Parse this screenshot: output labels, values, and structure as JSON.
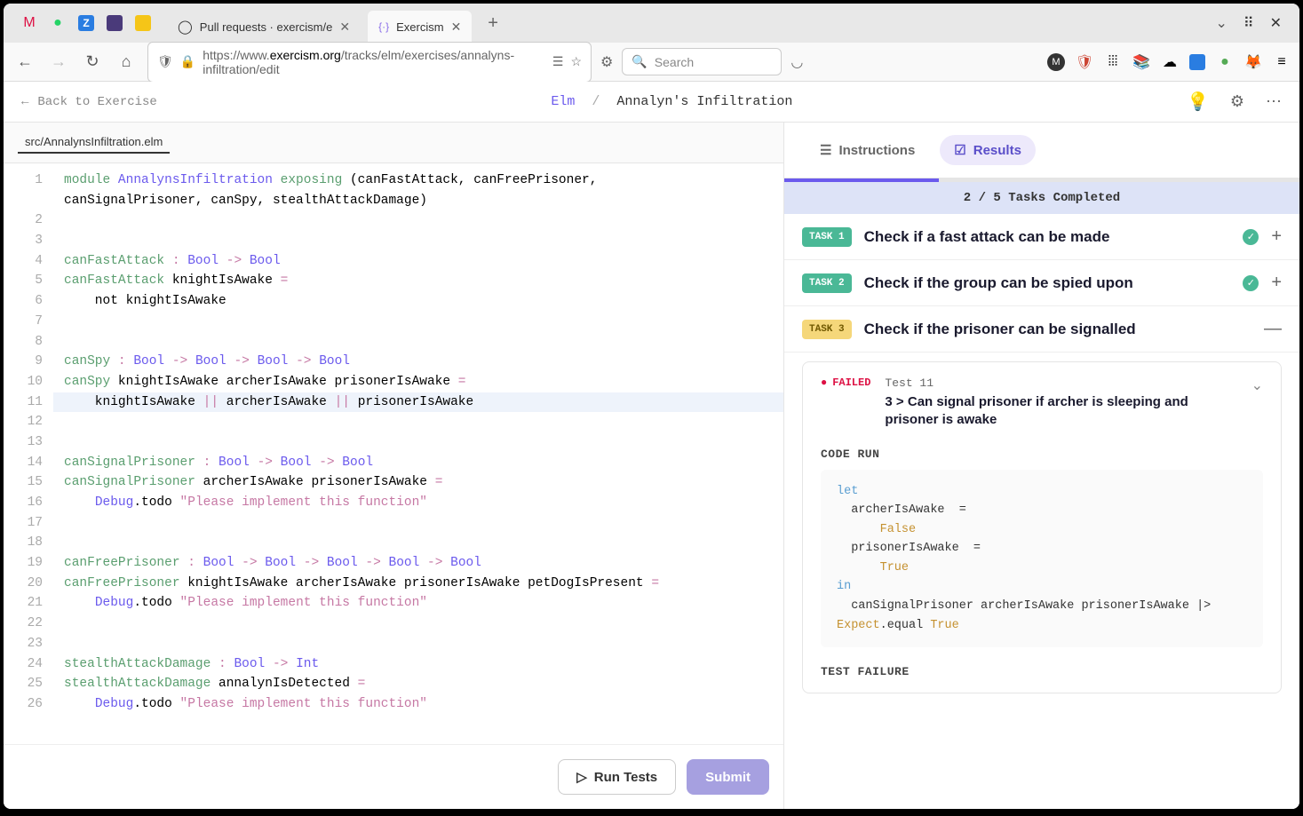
{
  "browser": {
    "tabs": [
      {
        "label": "Pull requests · exercism/e",
        "active": false
      },
      {
        "label": "Exercism",
        "active": true
      }
    ],
    "url_prefix": "https://www.",
    "url_domain": "exercism.org",
    "url_path": "/tracks/elm/exercises/annalyns-infiltration/edit",
    "search_placeholder": "Search"
  },
  "header": {
    "back_label": "Back to Exercise",
    "track": "Elm",
    "sep": "/",
    "exercise": "Annalyn's Infiltration"
  },
  "file_tab": "src/AnnalynsInfiltration.elm",
  "code_lines": [
    {
      "n": 1,
      "segs": [
        [
          "kw",
          "module "
        ],
        [
          "ty",
          "AnnalynsInfiltration "
        ],
        [
          "kw",
          "exposing "
        ],
        [
          "",
          "(canFastAttack, canFreePrisoner,"
        ]
      ]
    },
    {
      "n": "",
      "segs": [
        [
          "",
          "canSignalPrisoner, canSpy, stealthAttackDamage)"
        ]
      ]
    },
    {
      "n": 2,
      "segs": [
        [
          "",
          ""
        ]
      ]
    },
    {
      "n": 3,
      "segs": [
        [
          "",
          ""
        ]
      ]
    },
    {
      "n": 4,
      "segs": [
        [
          "ident",
          "canFastAttack "
        ],
        [
          "op",
          ": "
        ],
        [
          "ty",
          "Bool "
        ],
        [
          "op",
          "-> "
        ],
        [
          "ty",
          "Bool"
        ]
      ]
    },
    {
      "n": 5,
      "segs": [
        [
          "ident",
          "canFastAttack "
        ],
        [
          "",
          "knightIsAwake "
        ],
        [
          "op",
          "="
        ]
      ]
    },
    {
      "n": 6,
      "segs": [
        [
          "",
          "    not knightIsAwake"
        ]
      ]
    },
    {
      "n": 7,
      "segs": [
        [
          "",
          ""
        ]
      ]
    },
    {
      "n": 8,
      "segs": [
        [
          "",
          ""
        ]
      ]
    },
    {
      "n": 9,
      "segs": [
        [
          "ident",
          "canSpy "
        ],
        [
          "op",
          ": "
        ],
        [
          "ty",
          "Bool "
        ],
        [
          "op",
          "-> "
        ],
        [
          "ty",
          "Bool "
        ],
        [
          "op",
          "-> "
        ],
        [
          "ty",
          "Bool "
        ],
        [
          "op",
          "-> "
        ],
        [
          "ty",
          "Bool"
        ]
      ]
    },
    {
      "n": 10,
      "segs": [
        [
          "ident",
          "canSpy "
        ],
        [
          "",
          "knightIsAwake archerIsAwake prisonerIsAwake "
        ],
        [
          "op",
          "="
        ]
      ]
    },
    {
      "n": 11,
      "hl": true,
      "segs": [
        [
          "",
          "    knightIsAwake "
        ],
        [
          "op",
          "|| "
        ],
        [
          "",
          "archerIsAwake "
        ],
        [
          "op",
          "|| "
        ],
        [
          "",
          "prisonerIsAwake"
        ]
      ]
    },
    {
      "n": 12,
      "segs": [
        [
          "",
          ""
        ]
      ]
    },
    {
      "n": 13,
      "segs": [
        [
          "",
          ""
        ]
      ]
    },
    {
      "n": 14,
      "segs": [
        [
          "ident",
          "canSignalPrisoner "
        ],
        [
          "op",
          ": "
        ],
        [
          "ty",
          "Bool "
        ],
        [
          "op",
          "-> "
        ],
        [
          "ty",
          "Bool "
        ],
        [
          "op",
          "-> "
        ],
        [
          "ty",
          "Bool"
        ]
      ]
    },
    {
      "n": 15,
      "segs": [
        [
          "ident",
          "canSignalPrisoner "
        ],
        [
          "",
          "archerIsAwake prisonerIsAwake "
        ],
        [
          "op",
          "="
        ]
      ]
    },
    {
      "n": 16,
      "segs": [
        [
          "",
          "    "
        ],
        [
          "ty",
          "Debug"
        ],
        [
          "",
          ".todo "
        ],
        [
          "str",
          "\"Please implement this function\""
        ]
      ]
    },
    {
      "n": 17,
      "segs": [
        [
          "",
          ""
        ]
      ]
    },
    {
      "n": 18,
      "segs": [
        [
          "",
          ""
        ]
      ]
    },
    {
      "n": 19,
      "segs": [
        [
          "ident",
          "canFreePrisoner "
        ],
        [
          "op",
          ": "
        ],
        [
          "ty",
          "Bool "
        ],
        [
          "op",
          "-> "
        ],
        [
          "ty",
          "Bool "
        ],
        [
          "op",
          "-> "
        ],
        [
          "ty",
          "Bool "
        ],
        [
          "op",
          "-> "
        ],
        [
          "ty",
          "Bool "
        ],
        [
          "op",
          "-> "
        ],
        [
          "ty",
          "Bool"
        ]
      ]
    },
    {
      "n": 20,
      "segs": [
        [
          "ident",
          "canFreePrisoner "
        ],
        [
          "",
          "knightIsAwake archerIsAwake prisonerIsAwake petDogIsPresent "
        ],
        [
          "op",
          "="
        ]
      ]
    },
    {
      "n": 21,
      "segs": [
        [
          "",
          "    "
        ],
        [
          "ty",
          "Debug"
        ],
        [
          "",
          ".todo "
        ],
        [
          "str",
          "\"Please implement this function\""
        ]
      ]
    },
    {
      "n": 22,
      "segs": [
        [
          "",
          ""
        ]
      ]
    },
    {
      "n": 23,
      "segs": [
        [
          "",
          ""
        ]
      ]
    },
    {
      "n": 24,
      "segs": [
        [
          "ident",
          "stealthAttackDamage "
        ],
        [
          "op",
          ": "
        ],
        [
          "ty",
          "Bool "
        ],
        [
          "op",
          "-> "
        ],
        [
          "ty",
          "Int"
        ]
      ]
    },
    {
      "n": 25,
      "segs": [
        [
          "ident",
          "stealthAttackDamage "
        ],
        [
          "",
          "annalynIsDetected "
        ],
        [
          "op",
          "="
        ]
      ]
    },
    {
      "n": 26,
      "segs": [
        [
          "",
          "    "
        ],
        [
          "ty",
          "Debug"
        ],
        [
          "",
          ".todo "
        ],
        [
          "str",
          "\"Please implement this function\""
        ]
      ]
    }
  ],
  "actions": {
    "run_tests": "Run Tests",
    "submit": "Submit"
  },
  "results": {
    "tabs": {
      "instructions": "Instructions",
      "results": "Results"
    },
    "summary": "2 / 5 Tasks Completed",
    "tasks": [
      {
        "badge": "TASK 1",
        "title": "Check if a fast attack can be made",
        "status": "pass",
        "expanded": false
      },
      {
        "badge": "TASK 2",
        "title": "Check if the group can be spied upon",
        "status": "pass",
        "expanded": false
      },
      {
        "badge": "TASK 3",
        "title": "Check if the prisoner can be signalled",
        "status": "fail",
        "expanded": true
      }
    ],
    "test": {
      "status": "FAILED",
      "num": "Test 11",
      "desc": "3 > Can signal prisoner if archer is sleeping and prisoner is awake",
      "code_run_label": "CODE RUN",
      "failure_label": "TEST FAILURE",
      "code_lines": [
        {
          "segs": [
            [
              "kw2",
              "let"
            ]
          ]
        },
        {
          "segs": [
            [
              "",
              ""
            ]
          ]
        },
        {
          "segs": [
            [
              "",
              ""
            ]
          ]
        },
        {
          "segs": [
            [
              "",
              "  archerIsAwake  ="
            ]
          ]
        },
        {
          "segs": [
            [
              "",
              "      "
            ],
            [
              "val",
              "False"
            ]
          ]
        },
        {
          "segs": [
            [
              "",
              ""
            ]
          ]
        },
        {
          "segs": [
            [
              "",
              ""
            ]
          ]
        },
        {
          "segs": [
            [
              "",
              "  prisonerIsAwake  ="
            ]
          ]
        },
        {
          "segs": [
            [
              "",
              "      "
            ],
            [
              "val",
              "True"
            ]
          ]
        },
        {
          "segs": [
            [
              "kw2",
              "in"
            ]
          ]
        },
        {
          "segs": [
            [
              "",
              "  canSignalPrisoner archerIsAwake prisonerIsAwake |>"
            ]
          ]
        },
        {
          "segs": [
            [
              "mod",
              "Expect"
            ],
            [
              "",
              ".equal "
            ],
            [
              "val",
              "True"
            ]
          ]
        }
      ]
    }
  }
}
